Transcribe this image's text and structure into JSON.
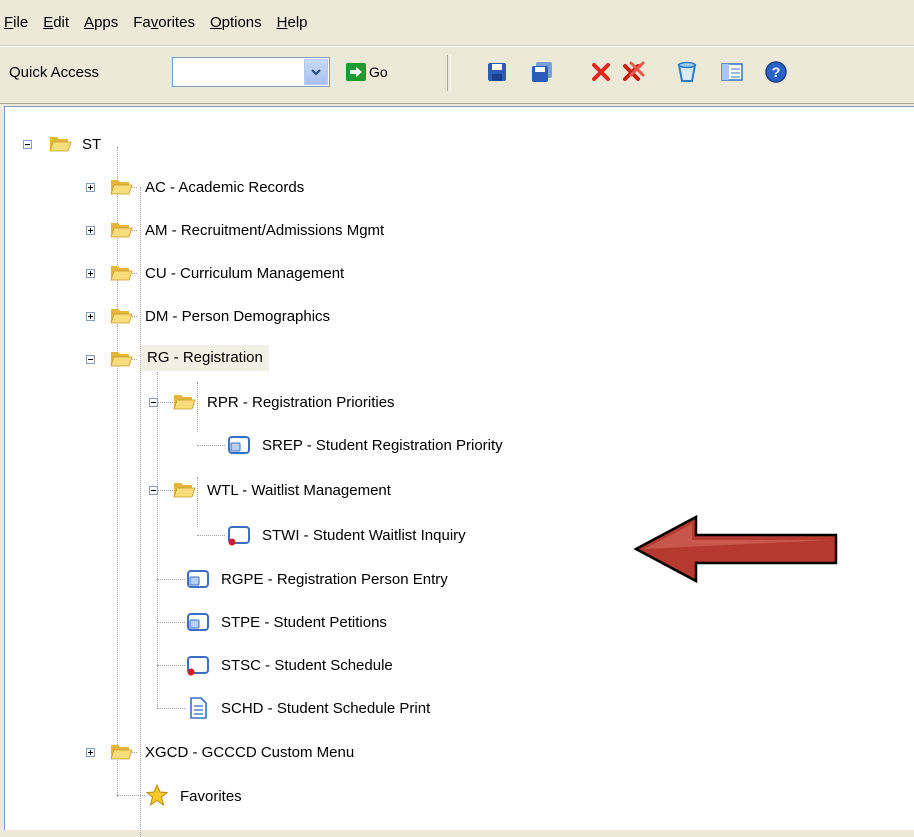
{
  "menubar": {
    "items": [
      {
        "label": "File",
        "hotkey_index": 0
      },
      {
        "label": "Edit",
        "hotkey_index": 0
      },
      {
        "label": "Apps",
        "hotkey_index": 0
      },
      {
        "label": "Favorites",
        "hotkey_index": 2
      },
      {
        "label": "Options",
        "hotkey_index": 0
      },
      {
        "label": "Help",
        "hotkey_index": 0
      }
    ]
  },
  "toolbar": {
    "quick_access_label": "Quick Access",
    "quick_access_value": "",
    "go_label": "Go",
    "buttons": [
      "save-icon",
      "save-all-icon",
      "delete-icon",
      "delete-all-icon",
      "clear-icon",
      "form-view-icon",
      "help-icon"
    ]
  },
  "tree": {
    "root": "ST",
    "nodes": [
      {
        "label": "AC - Academic Records",
        "type": "folder",
        "expanded": false
      },
      {
        "label": "AM - Recruitment/Admissions Mgmt",
        "type": "folder",
        "expanded": false
      },
      {
        "label": "CU - Curriculum Management",
        "type": "folder",
        "expanded": false
      },
      {
        "label": "DM - Person Demographics",
        "type": "folder",
        "expanded": false
      },
      {
        "label": "RG - Registration",
        "type": "folder",
        "expanded": true,
        "selected": true
      },
      {
        "label": "RPR - Registration Priorities",
        "type": "folder",
        "expanded": true
      },
      {
        "label": "SREP - Student Registration Priority",
        "type": "form"
      },
      {
        "label": "WTL - Waitlist Management",
        "type": "folder",
        "expanded": true
      },
      {
        "label": "STWI - Student Waitlist Inquiry",
        "type": "inquiry-form"
      },
      {
        "label": "RGPE - Registration Person Entry",
        "type": "form"
      },
      {
        "label": "STPE - Student Petitions",
        "type": "form"
      },
      {
        "label": "STSC - Student Schedule",
        "type": "inquiry-form"
      },
      {
        "label": "SCHD - Student Schedule Print",
        "type": "report"
      },
      {
        "label": "XGCD - GCCCD Custom Menu",
        "type": "folder",
        "expanded": false
      },
      {
        "label": "Favorites",
        "type": "favorites"
      }
    ]
  },
  "colors": {
    "chrome": "#ece9d8",
    "arrow": "#b5392f",
    "folder": "#f2d05e",
    "form_icon": "#4a7bd0"
  }
}
